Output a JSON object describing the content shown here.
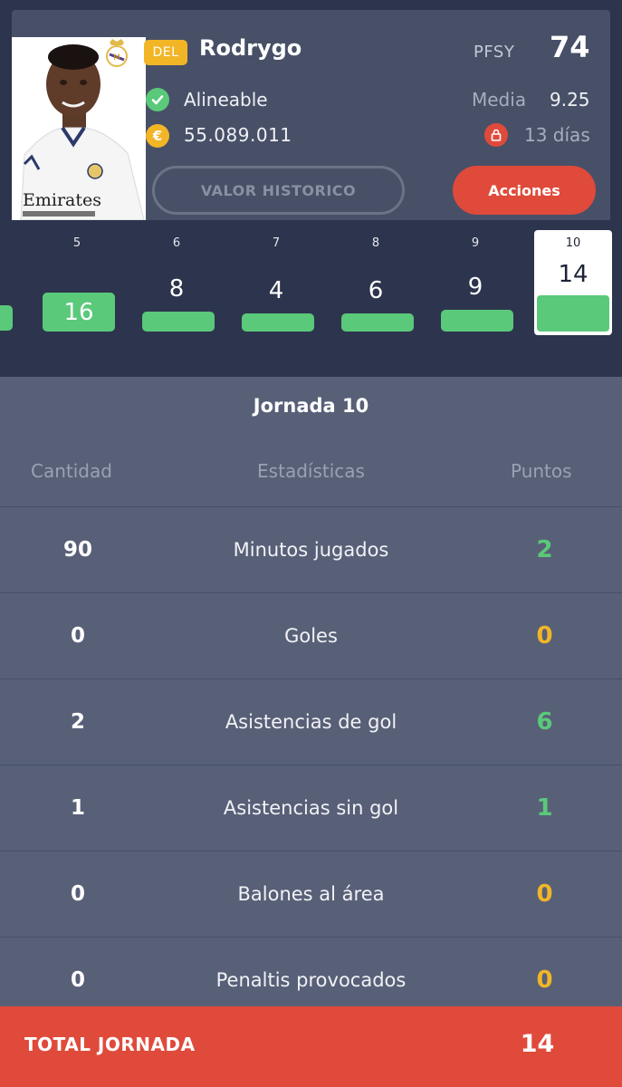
{
  "player": {
    "position": "DEL",
    "name": "Rodrygo",
    "pfsy_label": "PFSY",
    "pfsy_value": "74",
    "status": "Alineable",
    "media_label": "Media",
    "media_value": "9.25",
    "market_value": "55.089.011",
    "lock_days": "13 días",
    "shirt_sponsor": "Emirates"
  },
  "buttons": {
    "historico": "VALOR HISTORICO",
    "acciones": "Acciones"
  },
  "jornadas": [
    {
      "number": "5",
      "points": "16",
      "bar_height": 0.6
    },
    {
      "number": "6",
      "points": "8",
      "bar_height": 0.3
    },
    {
      "number": "7",
      "points": "4",
      "bar_height": 0.18
    },
    {
      "number": "8",
      "points": "6",
      "bar_height": 0.24
    },
    {
      "number": "9",
      "points": "9",
      "bar_height": 0.33
    },
    {
      "number": "10",
      "points": "14",
      "bar_height": 0.55,
      "selected": true
    }
  ],
  "stats": {
    "title": "Jornada 10",
    "headers": {
      "cantidad": "Cantidad",
      "estadisticas": "Estadísticas",
      "puntos": "Puntos"
    },
    "rows": [
      {
        "qty": "90",
        "name": "Minutos jugados",
        "points": "2",
        "color": "green"
      },
      {
        "qty": "0",
        "name": "Goles",
        "points": "0",
        "color": "orange"
      },
      {
        "qty": "2",
        "name": "Asistencias de gol",
        "points": "6",
        "color": "green"
      },
      {
        "qty": "1",
        "name": "Asistencias sin gol",
        "points": "1",
        "color": "green"
      },
      {
        "qty": "0",
        "name": "Balones al área",
        "points": "0",
        "color": "orange"
      },
      {
        "qty": "0",
        "name": "Penaltis provocados",
        "points": "0",
        "color": "orange"
      }
    ]
  },
  "total": {
    "label": "TOTAL JORNADA",
    "value": "14"
  },
  "colors": {
    "accent_red": "#e04a3b",
    "green": "#5ac97a",
    "orange": "#f2b526"
  }
}
